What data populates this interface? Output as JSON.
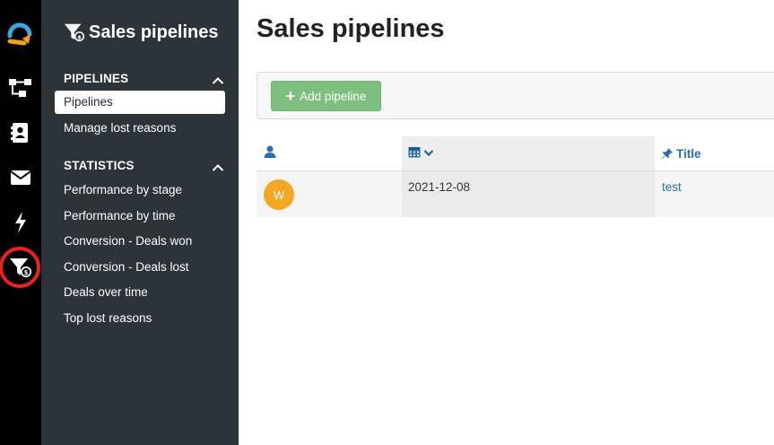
{
  "rail": {
    "items": [
      "logo-icon",
      "workflow-icon",
      "contacts-icon",
      "mail-icon",
      "automation-icon",
      "sales-pipelines-icon"
    ],
    "active": "sales-pipelines-icon",
    "active_ring_color": "#e8231d"
  },
  "sidebar": {
    "title": "Sales pipelines",
    "sections": [
      {
        "heading": "PIPELINES",
        "items": [
          "Pipelines",
          "Manage lost reasons"
        ]
      },
      {
        "heading": "STATISTICS",
        "items": [
          "Performance by stage",
          "Performance by time",
          "Conversion - Deals won",
          "Conversion - Deals lost",
          "Deals over time",
          "Top lost reasons"
        ]
      }
    ],
    "active_item": "Pipelines"
  },
  "main": {
    "title": "Sales pipelines",
    "toolbar": {
      "add_button_label": "Add pipeline"
    },
    "table": {
      "columns": [
        "",
        "",
        "Title"
      ],
      "rows": [
        {
          "avatar": "W",
          "date": "2021-12-08",
          "title": "test"
        }
      ]
    }
  },
  "colors": {
    "rail_bg": "#000000",
    "sidebar_bg": "#2c3339",
    "add_button": "#7cbf7f",
    "link": "#2a6fb0",
    "avatar": "#f5a623"
  }
}
